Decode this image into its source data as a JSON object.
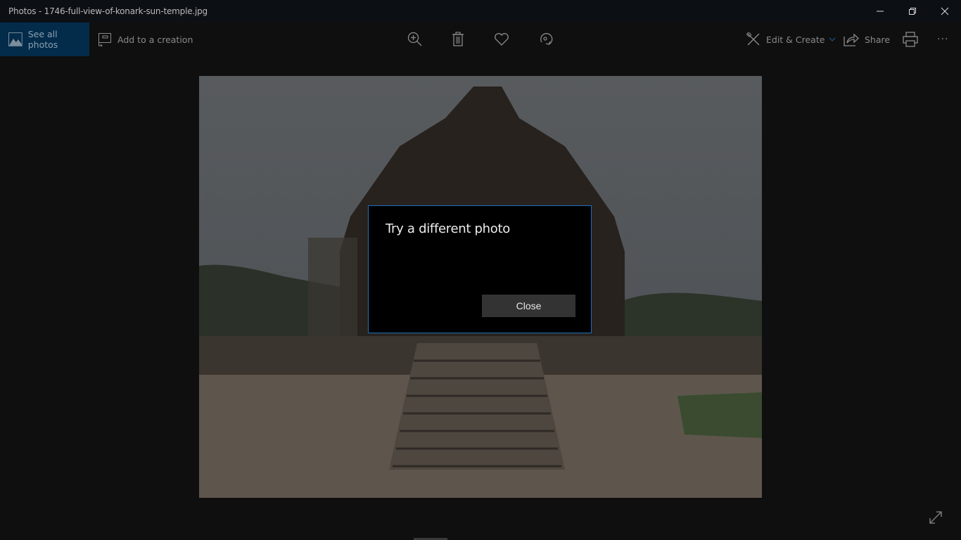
{
  "window": {
    "title": "Photos - 1746-full-view-of-konark-sun-temple.jpg",
    "minimize_icon": "minimize-icon",
    "restore_icon": "restore-icon",
    "close_icon": "close-icon"
  },
  "toolbar": {
    "see_all_photos": "See all photos",
    "add_to_creation": "Add to a creation",
    "zoom_icon": "zoom-in-icon",
    "delete_icon": "trash-icon",
    "favorite_icon": "heart-icon",
    "rotate_icon": "rotate-icon",
    "edit_create": "Edit & Create",
    "share": "Share",
    "print_icon": "printer-icon",
    "more": "···"
  },
  "photo": {
    "subject": "Konark Sun Temple full view"
  },
  "dialog": {
    "title": "Try a different photo",
    "close_label": "Close"
  },
  "colors": {
    "accent": "#1f6fbf",
    "see_all_bg": "#032b4a",
    "dialog_button": "#333333"
  }
}
